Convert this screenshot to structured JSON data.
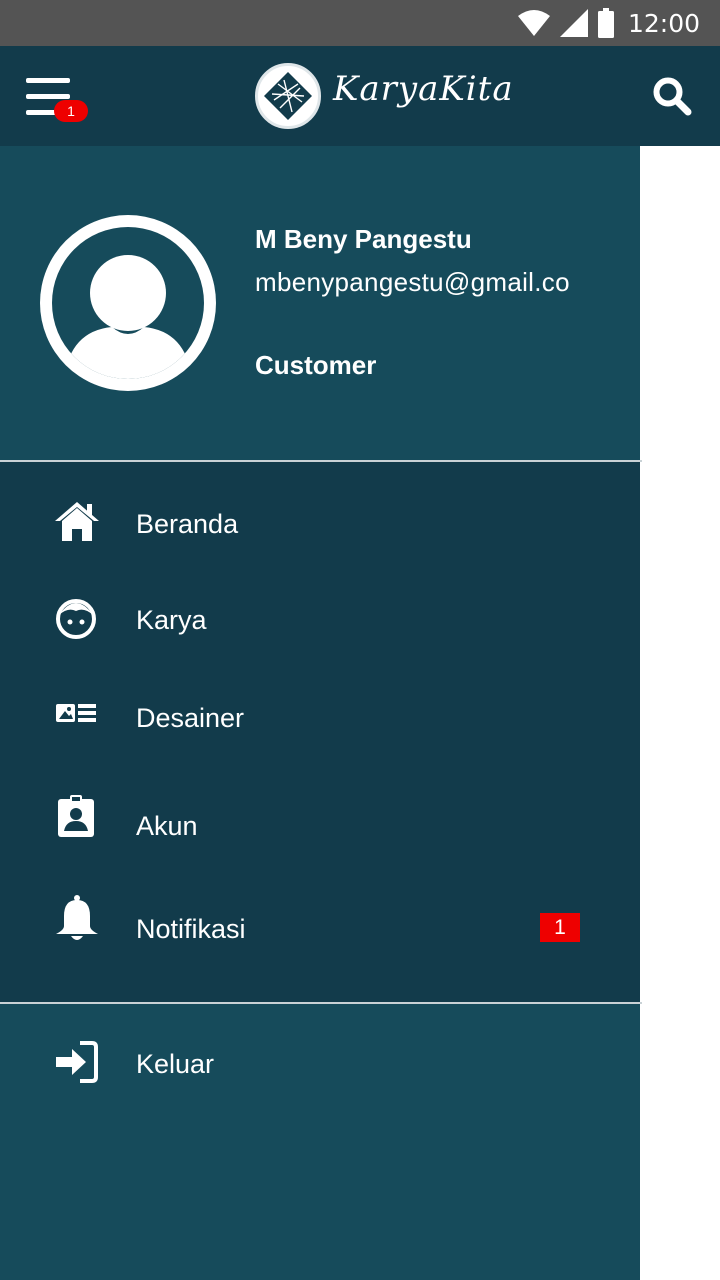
{
  "status_bar": {
    "time": "12:00"
  },
  "app_bar": {
    "brand": "KaryaKita",
    "menu_badge": "1"
  },
  "profile": {
    "name": "M Beny Pangestu",
    "email": "mbenypangestu@gmail.co",
    "role": "Customer"
  },
  "menu": {
    "items": [
      {
        "label": "Beranda",
        "icon": "home-icon"
      },
      {
        "label": "Karya",
        "icon": "face-icon"
      },
      {
        "label": "Desainer",
        "icon": "id-card-icon"
      },
      {
        "label": "Akun",
        "icon": "badge-icon"
      },
      {
        "label": "Notifikasi",
        "icon": "bell-icon",
        "badge": "1"
      }
    ],
    "logout": {
      "label": "Keluar",
      "icon": "sign-in-icon"
    }
  },
  "colors": {
    "app_bar": "#123b4b",
    "drawer_header": "#164b5b",
    "menu_bg": "#123b4b",
    "badge": "#ee0000"
  }
}
